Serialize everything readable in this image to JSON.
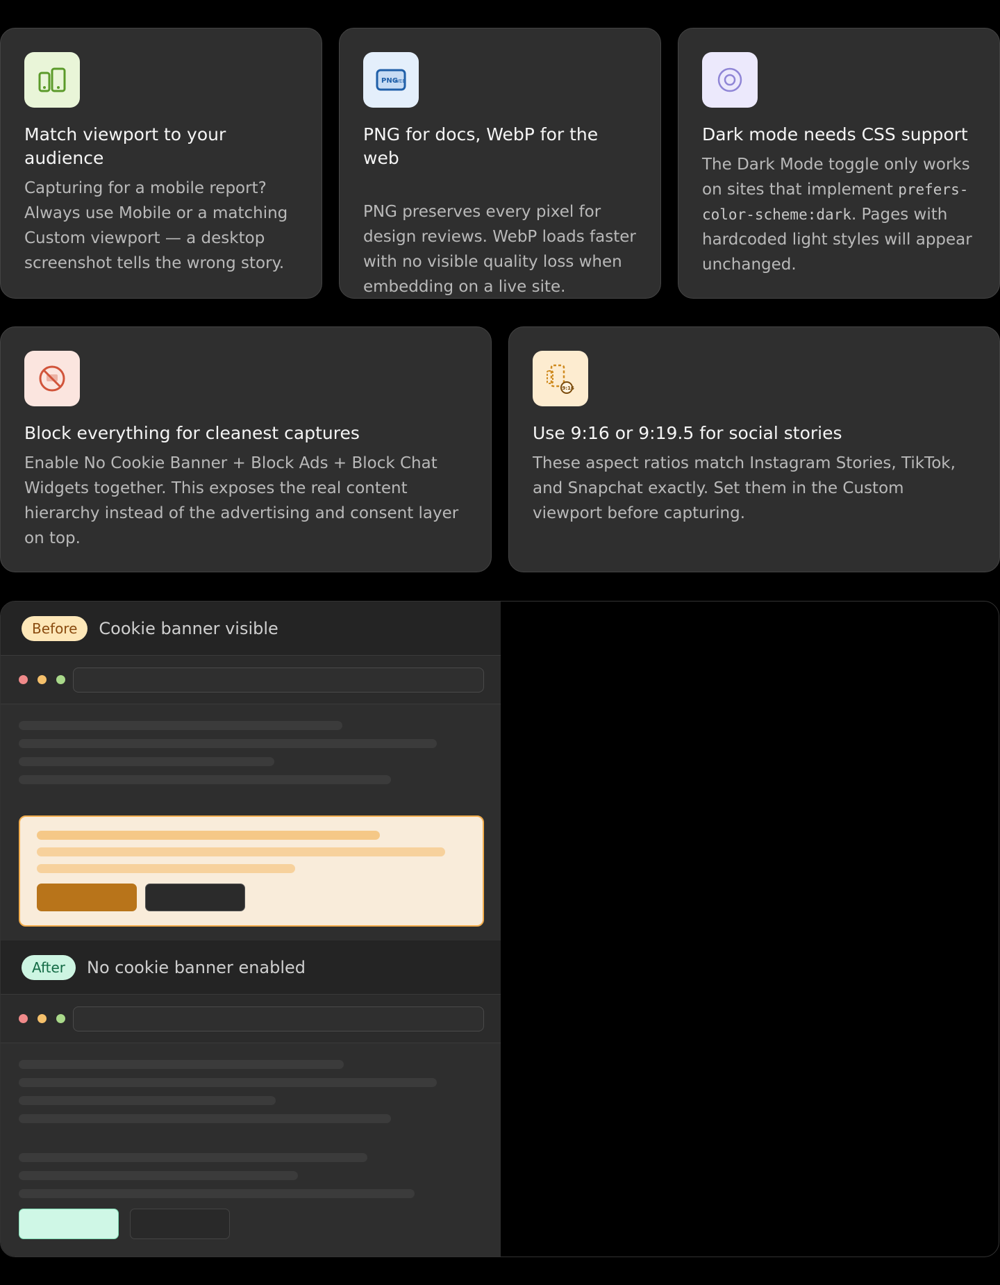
{
  "tips": [
    {
      "icon": "phone-tablet-icon",
      "title": "Match viewport to your audience",
      "body": "Capturing for a mobile report? Always use Mobile or a matching Custom viewport — a desktop screenshot tells the wrong story.",
      "icon_bg": "#e9f5d8",
      "icon_color": "#5b9a2a"
    },
    {
      "icon": "png-image-icon",
      "title": "PNG for docs, WebP for the web",
      "body": "PNG preserves every pixel for design reviews. WebP loads faster with no visible quality loss when embedding on a live site.",
      "icon_bg": "#e4effb",
      "icon_color": "#1f5fa8",
      "icon_text": "PNG",
      "icon_text_2": "WEB"
    },
    {
      "icon": "dark-mode-circle-icon",
      "title": "Dark mode needs CSS support",
      "body_pre": "The Dark Mode toggle only works on sites that implement ",
      "body_code": "prefers-color-scheme:dark",
      "body_post": ". Pages with hardcoded light styles will appear unchanged.",
      "icon_bg": "#ece9fc",
      "icon_color": "#8f85d6"
    },
    {
      "icon": "block-icon",
      "title": "Block everything for cleanest captures",
      "body": "Enable No Cookie Banner + Block Ads + Block Chat Widgets together. This exposes the real content hierarchy instead of the advertising and consent layer on top.",
      "icon_bg": "#fbe5df",
      "icon_color": "#d1543a"
    },
    {
      "icon": "aspect-ratio-phone-icon",
      "title": "Use 9:16 or 9:19.5 for social stories",
      "body": "These aspect ratios match Instagram Stories, TikTok, and Snapchat exactly. Set them in the Custom viewport before capturing.",
      "icon_bg": "#fdecd0",
      "icon_color": "#cf8a1f",
      "icon_text": "9:16"
    }
  ],
  "comparison": {
    "before": {
      "badge": "Before",
      "label": "Cookie banner visible"
    },
    "after": {
      "badge": "After",
      "label": "No cookie banner enabled"
    },
    "traffic_lights": [
      "#f08a8a",
      "#f5c06b",
      "#a9d98a"
    ],
    "accent_before": "#b8741a",
    "accent_after": "#cff7e6"
  }
}
